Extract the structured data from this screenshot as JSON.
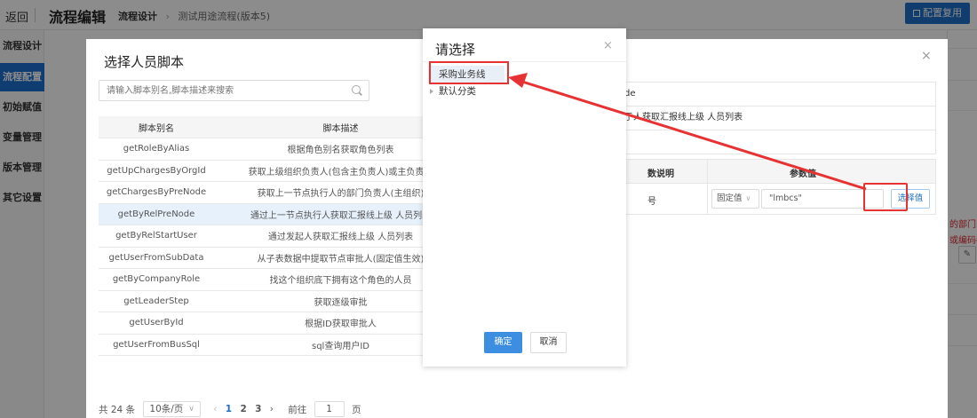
{
  "topbar": {
    "back": "返回",
    "title": "流程编辑",
    "breadcrumb_current": "流程设计",
    "breadcrumb_sep": "›",
    "breadcrumb_tail": "测试用途流程(版本5)",
    "reuse_button": "配置复用"
  },
  "sidebar": {
    "items": [
      {
        "label": "流程设计"
      },
      {
        "label": "流程配置"
      },
      {
        "label": "初始赋值"
      },
      {
        "label": "变量管理"
      },
      {
        "label": "版本管理"
      },
      {
        "label": "其它设置"
      }
    ]
  },
  "right_edge": {
    "warn_line1": "的部门",
    "warn_line2": "或编码都",
    "mini_icon": "edit-icon"
  },
  "script_dialog": {
    "title": "选择人员脚本",
    "close": "×",
    "search_placeholder": "请输入脚本别名,脚本描述来搜索",
    "columns": [
      "脚本别名",
      "脚本描述"
    ],
    "rows": [
      [
        "getRoleByAlias",
        "根据角色别名获取角色列表"
      ],
      [
        "getUpChargesByOrgId",
        "获取上级组织负责人(包含主负责人)或主负责人"
      ],
      [
        "getChargesByPreNode",
        "获取上一节点执行人的部门负责人(主组织)"
      ],
      [
        "getByRelPreNode",
        "通过上一节点执行人获取汇报线上级 人员列表"
      ],
      [
        "getByRelStartUser",
        "通过发起人获取汇报线上级 人员列表"
      ],
      [
        "getUserFromSubData",
        "从子表数据中提取节点审批人(固定值生效)"
      ],
      [
        "getByCompanyRole",
        "找这个组织底下拥有这个角色的人员"
      ],
      [
        "getLeaderStep",
        "获取逐级审批"
      ],
      [
        "getUserById",
        "根据ID获取审批人"
      ],
      [
        "getUserFromBusSql",
        "sql查询用户ID"
      ]
    ],
    "selected_row": 3,
    "pager": {
      "total": "共 24 条",
      "size": "10条/页",
      "prev": "‹",
      "pages": [
        "1",
        "2",
        "3"
      ],
      "current_page": "1",
      "next": "›",
      "goto_label": "前往",
      "goto_value": "1",
      "page_unit": "页"
    },
    "detail": {
      "name_fragment": "de",
      "desc_fragment": "亍人获取汇报线上级 人员列表",
      "param_header_desc": "数说明",
      "param_header_value": "参数值",
      "param_desc_fragment": "号",
      "value_type": "固定值",
      "value": "\"lmbcs\"",
      "pick_button": "选择值"
    }
  },
  "choose_dialog": {
    "title": "请选择",
    "close": "×",
    "nodes": [
      {
        "label": "采购业务线"
      },
      {
        "label": "默认分类"
      }
    ],
    "ok": "确定",
    "cancel": "取消"
  }
}
